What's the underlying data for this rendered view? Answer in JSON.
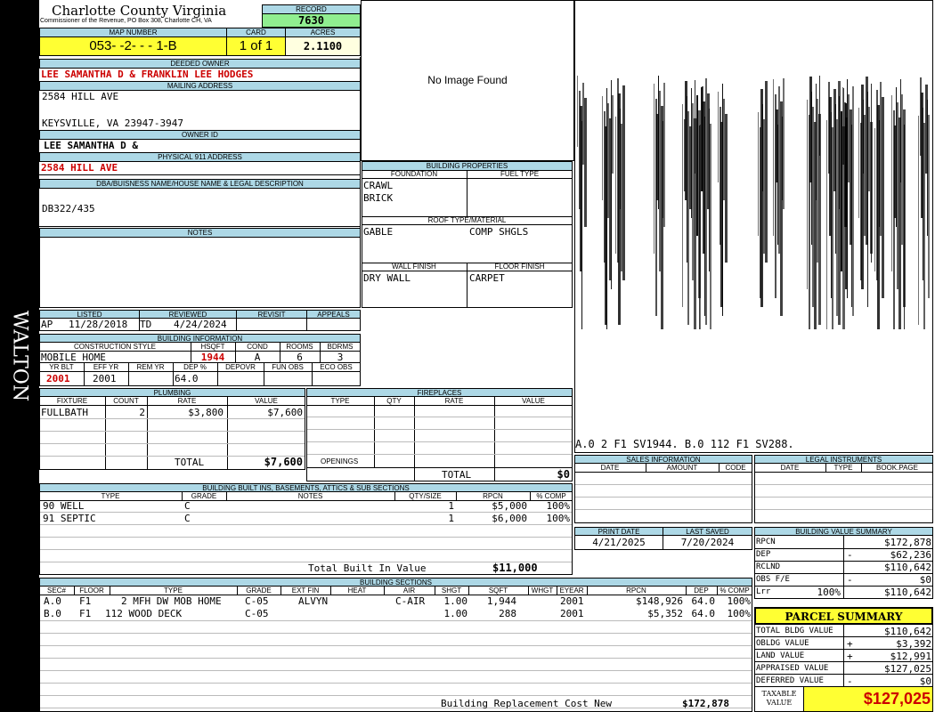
{
  "side": {
    "label": "WALTON"
  },
  "header": {
    "title": "Charlotte County Virginia",
    "subtitle": "Commissioner of the Revenue, PO Box 308, Charlotte CH, VA"
  },
  "record": {
    "label": "RECORD",
    "value": "7630"
  },
  "map": {
    "label": "MAP NUMBER",
    "value": "053-  -2-  -  -  1-B"
  },
  "card": {
    "label": "CARD",
    "value": "1 of 1"
  },
  "acres": {
    "label": "ACRES",
    "value": "2.1100"
  },
  "owner": {
    "label": "DEEDED OWNER",
    "value": "LEE SAMANTHA D & FRANKLIN LEE HODGES"
  },
  "mailing": {
    "label": "MAILING ADDRESS",
    "line1": "2584 HILL AVE",
    "line2": "KEYSVILLE, VA 23947-3947"
  },
  "owner_id": {
    "label": "OWNER ID",
    "value": "LEE SAMANTHA D &"
  },
  "physical": {
    "label": "PHYSICAL 911 ADDRESS",
    "value": "2584 HILL AVE"
  },
  "dba": {
    "label": "DBA/BUISNESS NAME/HOUSE NAME & LEGAL DESCRIPTION",
    "value": "DB322/435"
  },
  "notes": {
    "label": "NOTES"
  },
  "image": {
    "text": "No Image Found"
  },
  "bp": {
    "label": "BUILDING PROPERTIES",
    "foundation_label": "FOUNDATION",
    "fuel_label": "FUEL TYPE",
    "foundation1": "CRAWL",
    "foundation2": "BRICK",
    "roof_label": "ROOF TYPE/MATERIAL",
    "roof_type": "GABLE",
    "roof_material": "COMP SHGLS",
    "wall_label": "WALL FINISH",
    "floor_label": "FLOOR FINISH",
    "wall": "DRY WALL",
    "floor": "CARPET"
  },
  "sketch": {
    "caption": "A.0  2   F1  SV1944.    B.0  112  F1  SV288."
  },
  "status": {
    "listed_label": "LISTED",
    "reviewed_label": "REVIEWED",
    "revisit_label": "REVISIT",
    "appeals_label": "APPEALS",
    "listed_code": "AP",
    "listed_date": "11/28/2018",
    "reviewed_code": "TD",
    "reviewed_date": "4/24/2024"
  },
  "bi": {
    "label": "BUILDING INFORMATION",
    "style_label": "CONSTRUCTION STYLE",
    "hsqft_label": "HSQFT",
    "cond_label": "COND",
    "rooms_label": "ROOMS",
    "bdrms_label": "BDRMS",
    "style": "MOBILE HOME",
    "hsqft": "1944",
    "cond": "A",
    "rooms": "6",
    "bdrms": "3",
    "yrblt_label": "YR BLT",
    "effyr_label": "EFF YR",
    "remyr_label": "REM YR",
    "dep_label": "DEP %",
    "depovr_label": "DEPOVR",
    "funobs_label": "FUN OBS",
    "ecoobs_label": "ECO OBS",
    "yrblt": "2001",
    "effyr": "2001",
    "dep": "64.0"
  },
  "plumbing": {
    "label": "PLUMBING",
    "cols": [
      "FIXTURE",
      "COUNT",
      "RATE",
      "VALUE"
    ],
    "row": {
      "fixture": "FULLBATH",
      "count": "2",
      "rate": "$3,800",
      "value": "$7,600"
    },
    "total_label": "TOTAL",
    "total": "$7,600"
  },
  "fireplaces": {
    "label": "FIREPLACES",
    "cols": [
      "TYPE",
      "QTY",
      "RATE",
      "VALUE"
    ],
    "openings_label": "OPENINGS",
    "total_label": "TOTAL",
    "total": "$0"
  },
  "builtins": {
    "label": "BUILDING BUILT INS, BASEMENTS, ATTICS & SUB SECTIONS",
    "cols": [
      "TYPE",
      "GRADE",
      "NOTES",
      "QTY/SIZE",
      "RPCN",
      "% COMP"
    ],
    "rows": [
      {
        "type": "90 WELL",
        "grade": "C",
        "qty": "1",
        "rpcn": "$5,000",
        "comp": "100%"
      },
      {
        "type": "91 SEPTIC",
        "grade": "C",
        "qty": "1",
        "rpcn": "$6,000",
        "comp": "100%"
      }
    ],
    "total_label": "Total Built In Value",
    "total": "$11,000"
  },
  "sales": {
    "label": "SALES INFORMATION",
    "cols": [
      "DATE",
      "AMOUNT",
      "CODE"
    ]
  },
  "legal": {
    "label": "LEGAL INSTRUMENTS",
    "cols": [
      "DATE",
      "TYPE",
      "BOOK.PAGE"
    ]
  },
  "dates": {
    "print_label": "PRINT DATE",
    "saved_label": "LAST SAVED",
    "print": "4/21/2025",
    "saved": "7/20/2024"
  },
  "bvs": {
    "label": "BUILDING VALUE SUMMARY",
    "rows": [
      {
        "k": "RPCN",
        "s": "",
        "v": "$172,878"
      },
      {
        "k": "DEP",
        "s": "-",
        "v": "$62,236"
      },
      {
        "k": "RCLND",
        "s": "",
        "v": "$110,642"
      },
      {
        "k": "OBS F/E",
        "s": "-",
        "v": "$0"
      },
      {
        "k": "Lrr",
        "p": "100%",
        "s": "",
        "v": "$110,642"
      }
    ]
  },
  "sections": {
    "label": "BUILDING SECTIONS",
    "cols": [
      "SEC#",
      "FLOOR",
      "TYPE",
      "GRADE",
      "EXT FIN",
      "HEAT",
      "AIR",
      "SHGT",
      "SQFT",
      "WHGT",
      "EYEAR",
      "RPCN",
      "DEP",
      "% COMP"
    ],
    "rows": [
      {
        "sec": "A.0",
        "floor": "F1",
        "type": "2 MFH DW MOB HOME",
        "grade": "C-05",
        "ext": "ALVYN",
        "heat": "",
        "air": "C-AIR",
        "shgt": "1.00",
        "sqft": "1,944",
        "whgt": "",
        "eyear": "2001",
        "rpcn": "$148,926",
        "dep": "64.0",
        "comp": "100%"
      },
      {
        "sec": "B.0",
        "floor": "F1",
        "type": "112 WOOD DECK",
        "grade": "C-05",
        "ext": "",
        "heat": "",
        "air": "",
        "shgt": "1.00",
        "sqft": "288",
        "whgt": "",
        "eyear": "2001",
        "rpcn": "$5,352",
        "dep": "64.0",
        "comp": "100%"
      }
    ],
    "brcn_label": "Building Replacement Cost New",
    "brcn": "$172,878"
  },
  "parcel": {
    "label": "PARCEL SUMMARY",
    "rows": [
      {
        "k": "TOTAL BLDG VALUE",
        "s": "",
        "v": "$110,642"
      },
      {
        "k": "OBLDG VALUE",
        "s": "+",
        "v": "$3,392"
      },
      {
        "k": "LAND VALUE",
        "s": "+",
        "v": "$12,991"
      },
      {
        "k": "APPRAISED VALUE",
        "s": "",
        "v": "$127,025"
      },
      {
        "k": "DEFERRED VALUE",
        "s": "-",
        "v": "$0"
      }
    ],
    "taxable_label1": "TAXABLE",
    "taxable_label2": "VALUE",
    "taxable": "$127,025"
  }
}
